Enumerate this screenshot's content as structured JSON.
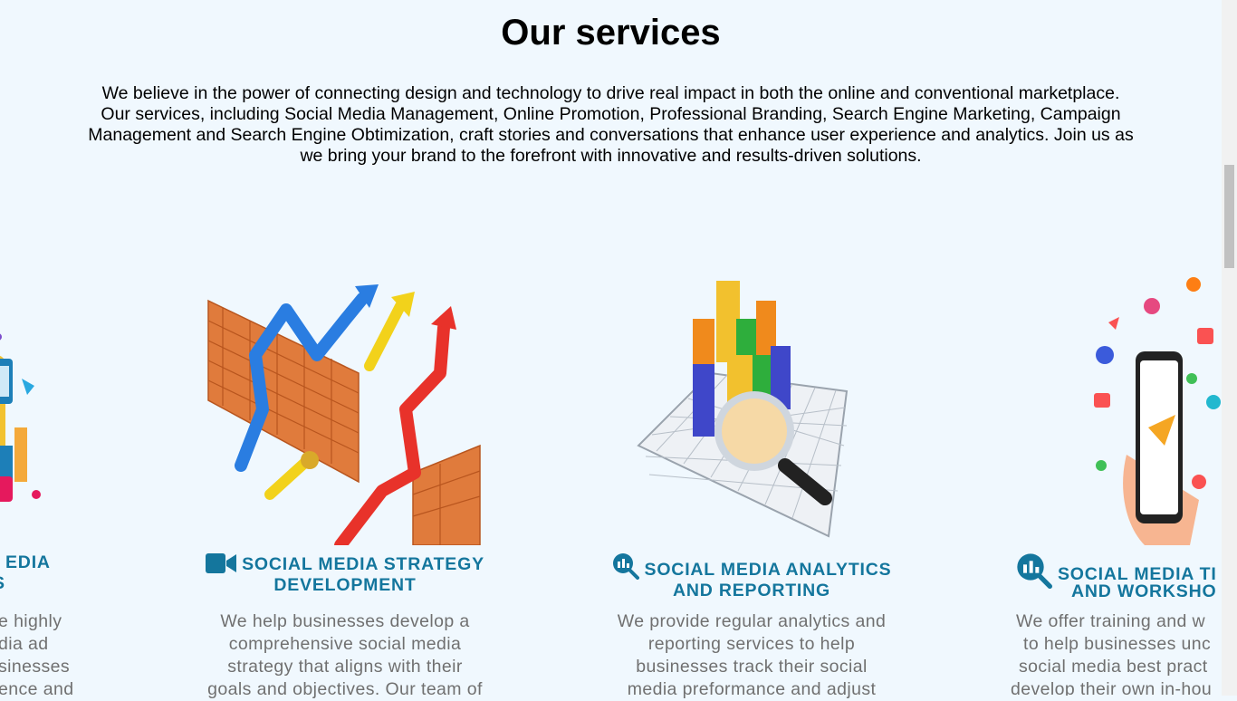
{
  "services": {
    "title": "Our services",
    "intro_lines": [
      "We believe in the power of connecting design and technology to drive real impact in both the online and conventional marketplace.",
      "Our services, including Social Media Management, Online Promotion, Professional Branding, Search Engine Marketing, Campaign",
      "Management and Search Engine Obtimization, craft stories and conversations that enhance user experience and analytics. Join us as",
      "we bring your brand to the forefront with innovative and results-driven solutions."
    ]
  },
  "cards": [
    {
      "icon": "megaphone-icon",
      "title_lines": [
        "EDIA",
        "S"
      ],
      "text_lines": [
        "e highly",
        "dia ad",
        "sinesses",
        "ence and"
      ]
    },
    {
      "icon": "video-camera-icon",
      "title_lines": [
        "SOCIAL MEDIA STRATEGY",
        "DEVELOPMENT"
      ],
      "text_lines": [
        "We help businesses develop a",
        "comprehensive social media",
        "strategy that aligns with their",
        "goals and objectives. Our team of"
      ]
    },
    {
      "icon": "search-analytics-icon",
      "title_lines": [
        "SOCIAL MEDIA ANALYTICS",
        "AND REPORTING"
      ],
      "text_lines": [
        "We provide regular analytics and",
        "reporting services to help",
        "businesses track their social",
        "media preformance and adjust"
      ]
    },
    {
      "icon": "search-analytics-icon",
      "title_lines": [
        "SOCIAL MEDIA TI",
        "AND WORKSHO"
      ],
      "text_lines": [
        "We offer training and w",
        "to help businesses unc",
        "social media best pract",
        "develop their own in-hou"
      ]
    }
  ],
  "colors": {
    "background": "#f0f8fe",
    "title_blue": "#14769d",
    "body_gray": "#707070"
  }
}
